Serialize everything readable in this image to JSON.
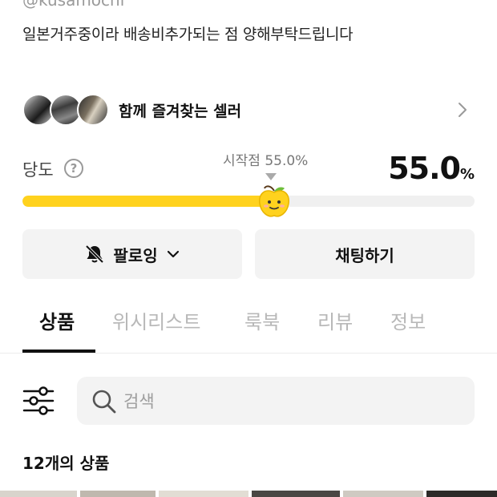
{
  "profile": {
    "handle": "@kusamochi",
    "bio": "일본거주중이라 배송비추가되는 점 양해부탁드립니다"
  },
  "favorite_sellers": {
    "label": "함께 즐겨찾는 셀러",
    "arrow_icon": "chevron-right-icon"
  },
  "sweetness": {
    "label": "당도",
    "help_icon": "question-circle-icon",
    "start_label": "시작점 55.0%",
    "score": "55.0",
    "unit": "%",
    "level": 0.55,
    "fill_color": "#ffd21e",
    "mascot_icon": "yellow-apple-mascot-icon"
  },
  "actions": {
    "follow_label": "팔로잉",
    "follow_icon": "bell-off-icon",
    "chat_label": "채팅하기"
  },
  "tabs": [
    {
      "label": "상품",
      "active": true
    },
    {
      "label": "위시리스트",
      "active": false
    },
    {
      "label": "룩북",
      "active": false
    },
    {
      "label": "리뷰",
      "active": false
    },
    {
      "label": "정보",
      "active": false
    }
  ],
  "search": {
    "placeholder": "검색",
    "filter_icon": "sliders-icon",
    "search_icon": "magnifier-icon"
  },
  "products": {
    "count_label": "12개의 상품"
  }
}
